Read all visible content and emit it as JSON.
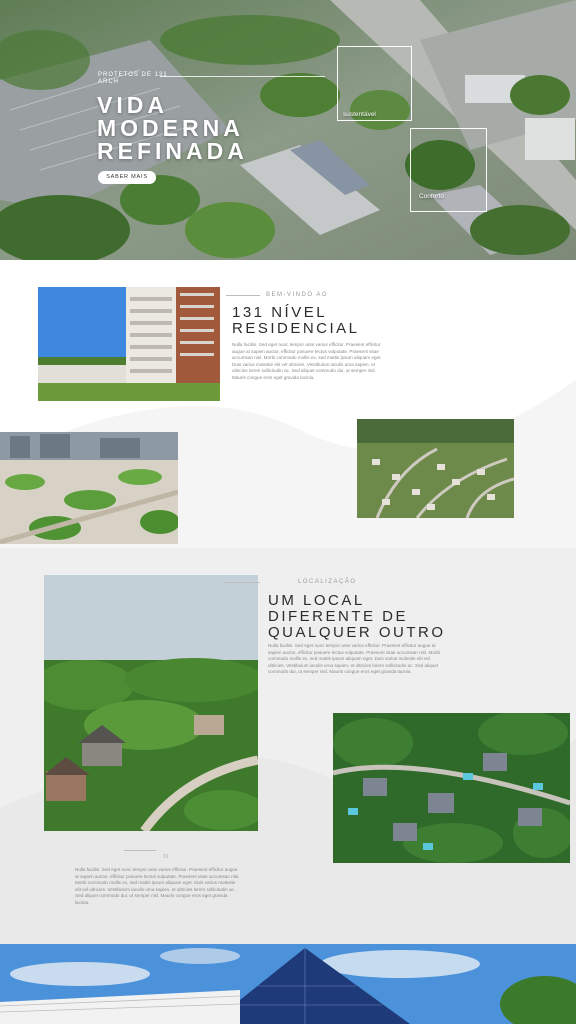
{
  "hero": {
    "eyebrow": "Protetos de 131 Arch",
    "title_line1": "VIDA",
    "title_line2": "MODERNA",
    "title_line3": "REFINADA",
    "button_label": "SABER MAIS",
    "frame1_label": "sustentável",
    "frame2_label": "Conforto"
  },
  "welcome": {
    "eyebrow": "BEM-VINDO AO",
    "heading_line1": "131 NÍVEL",
    "heading_line2": "RESIDENCIAL",
    "paragraph": [
      "Nulla facilisi. Sed eget nunc tempor ante varius efficitur. Praesent efficitur",
      "augue at sapien auctor, efficitur posuere lectus vulputate. Praesent vitae",
      "accumsan nisl. Morbi commodo mollis ex, sed mattis ipsum aliquam eget.",
      "Duis varius molestie elit vel ultricies. Vestibulum iaculis urna sapien, et",
      "ultricies lorem sollicitudin ac. Sed aliquet commodo dui, ut semper nisl.",
      "Mauris congue eros eget gravida lacinia."
    ]
  },
  "location": {
    "eyebrow": "LOCALIZAÇÃO",
    "heading_line1": "UM LOCAL",
    "heading_line2": "DIFERENTE DE",
    "heading_line3": "QUALQUER OUTRO",
    "paragraph": [
      "Nulla facilisi. Sed eget nunc tempor ante varius efficitur. Praesent efficitur augue at",
      "sapien auctor, efficitur posuere lectus vulputate. Praesent vitae accumsan nisl. Morbi",
      "commodo mollis ex, sed mattis ipsum aliquam eget. Duis varius molestie elit vel",
      "ultricies. Vestibulum iaculis urna sapien, et ultricies lorem sollicitudin ac. Sed aliquet",
      "commodo dui, ut semper nisl. Mauris congue eros eget gravida lacinia."
    ],
    "number": "01",
    "paragraph2": [
      "Nulla facilisi. Sed eget nunc tempor ante varius efficitur. Praesent efficitur augue",
      "at sapien auctor, efficitur posuere lectus vulputate. Praesent vitae accumsan nisl.",
      "Morbi commodo mollis ex, sed mattis ipsum aliquam eget. Duis varius molestie",
      "elit vel ultricies. Vestibulum iaculis urna sapien, et ultricies lorem sollicitudin ac.",
      "Sed aliquet commodo dui, ut semper nisl. Mauris congue eros eget gravida",
      "lacinia."
    ]
  }
}
